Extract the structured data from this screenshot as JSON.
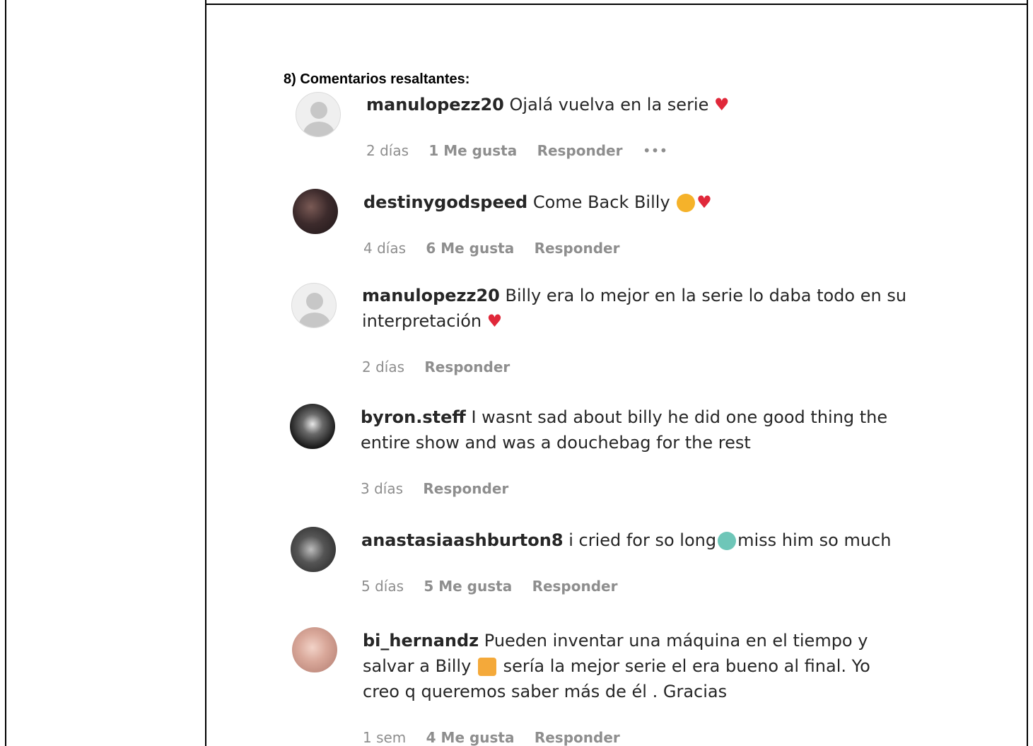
{
  "heading": "8) Comentarios resaltantes:",
  "comments": [
    {
      "user": "manulopezz20",
      "text_lines": [
        "Ojalá vuelva en la serie"
      ],
      "emoji_end": [
        "heart"
      ],
      "meta": [
        "2 días",
        "1 Me gusta",
        "Responder",
        "•••"
      ]
    },
    {
      "user": "destinygodspeed",
      "text_lines": [
        "Come Back Billy"
      ],
      "emoji_end": [
        "sad-face",
        "heart"
      ],
      "meta": [
        "4 días",
        "6 Me gusta",
        "Responder"
      ]
    },
    {
      "user": "manulopezz20",
      "text_lines": [
        "Billy era lo mejor en la serie lo daba todo en su",
        "interpretación"
      ],
      "emoji_end": [
        "heart"
      ],
      "meta": [
        "2 días",
        "Responder"
      ]
    },
    {
      "user": "byron.steff",
      "text_lines": [
        "I wasnt sad about billy he did one good thing the",
        "entire show and was a douchebag for the rest"
      ],
      "meta": [
        "3 días",
        "Responder"
      ]
    },
    {
      "user": "anastasiaashburton8",
      "text_lines": [
        "i cried for so long",
        "miss him so much"
      ],
      "emoji_end": [
        "crying-face"
      ],
      "meta": [
        "5 días",
        "5 Me gusta",
        "Responder"
      ]
    },
    {
      "user": "bi_hernandz",
      "text_lines": [
        "Pueden inventar una máquina en el tiempo y",
        "salvar a Billy",
        "sería la mejor serie el era bueno al final. Yo",
        "creo q queremos saber más de él . Gracias"
      ],
      "emoji_end": [
        "praying-hands"
      ],
      "meta": [
        "1 sem",
        "4 Me gusta",
        "Responder"
      ]
    }
  ]
}
